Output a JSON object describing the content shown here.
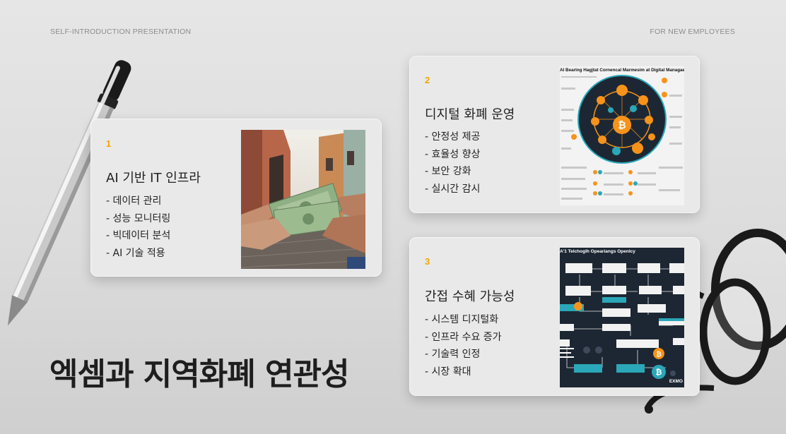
{
  "header": {
    "left_label": "SELF-INTRODUCTION PRESENTATION",
    "right_label": "FOR NEW EMPLOYEES"
  },
  "cards": [
    {
      "number": "1",
      "title": "AI 기반 IT 인프라",
      "bullets": [
        "- 데이터 관리",
        "- 성능 모니터링",
        "- 빅데이터 분석",
        "- AI 기술 적용"
      ],
      "image": "hands-exchanging-dollars-photo"
    },
    {
      "number": "2",
      "title": "디지털 화폐 운영",
      "bullets": [
        "- 안정성 제공",
        "- 효율성 향상",
        "- 보안 강화",
        "- 실시간 감시"
      ],
      "image": "bitcoin-network-infographic",
      "image_caption": "AI Bearing Hagjtat Cornencal Marmesim at Digital Managaeerment"
    },
    {
      "number": "3",
      "title": "간접 수혜 가능성",
      "bullets": [
        "- 시스템 디지털화",
        "- 인프라 수요 증가",
        "- 기술력 인정",
        "- 시장 확대"
      ],
      "image": "flowchart-diagram",
      "image_caption": "A'1 Telchoglh Opeariangs Openlcy",
      "image_logo": "EXMO"
    }
  ],
  "headline": "엑셈과 지역화폐 연관성",
  "colors": {
    "accent": "#f0a500",
    "bitcoin": "#f7931a",
    "teal": "#2aa7b8",
    "dark": "#1d2733"
  }
}
